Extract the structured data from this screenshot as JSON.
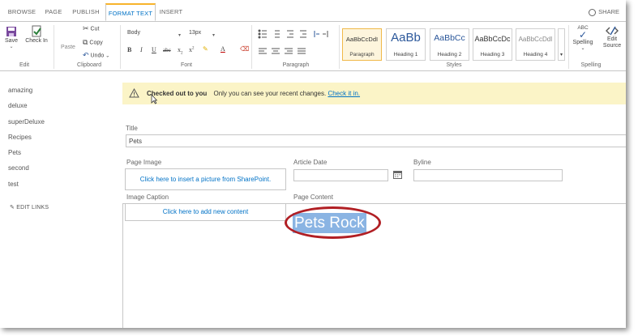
{
  "ribbon_tabs": [
    "BROWSE",
    "PAGE",
    "PUBLISH",
    "FORMAT TEXT",
    "INSERT"
  ],
  "active_tab": "FORMAT TEXT",
  "share_label": "SHARE",
  "ribbon": {
    "edit": {
      "save": "Save",
      "check_in": "Check In",
      "label": "Edit"
    },
    "clipboard": {
      "paste": "Paste",
      "cut": "Cut",
      "copy": "Copy",
      "undo": "Undo",
      "label": "Clipboard"
    },
    "font": {
      "family": "Body",
      "size": "13px",
      "label": "Font"
    },
    "paragraph": {
      "label": "Paragraph"
    },
    "styles": {
      "items": [
        {
          "sample": "AaBbCcDdI",
          "name": "Paragraph"
        },
        {
          "sample": "AaBb",
          "name": "Heading 1"
        },
        {
          "sample": "AaBbCc",
          "name": "Heading 2"
        },
        {
          "sample": "AaBbCcDc",
          "name": "Heading 3"
        },
        {
          "sample": "AaBbCcDdI",
          "name": "Heading 4"
        }
      ],
      "label": "Styles"
    },
    "spelling": {
      "spelling": "Spelling",
      "edit_source": "Edit Source",
      "label": "Spelling",
      "abc": "ABC"
    }
  },
  "left_nav": {
    "items": [
      "amazing",
      "deluxe",
      "superDeluxe",
      "Recipes",
      "Pets",
      "second",
      "test"
    ],
    "edit_links": "EDIT LINKS"
  },
  "status": {
    "title": "Checked out to you",
    "message": "Only you can see your recent changes.",
    "link": "Check it in."
  },
  "form": {
    "title_label": "Title",
    "title_value": "Pets",
    "page_image_label": "Page Image",
    "page_image_link": "Click here to insert a picture from SharePoint.",
    "article_date_label": "Article Date",
    "byline_label": "Byline",
    "image_caption_label": "Image Caption",
    "image_caption_link": "Click here to add new content",
    "page_content_label": "Page Content",
    "page_content_text": "Pets Rock"
  },
  "colors": {
    "accent": "#0072c6",
    "status_bg": "#fbf4c7",
    "highlight_ring": "#b11f24",
    "selection": "#8ab4e3"
  }
}
